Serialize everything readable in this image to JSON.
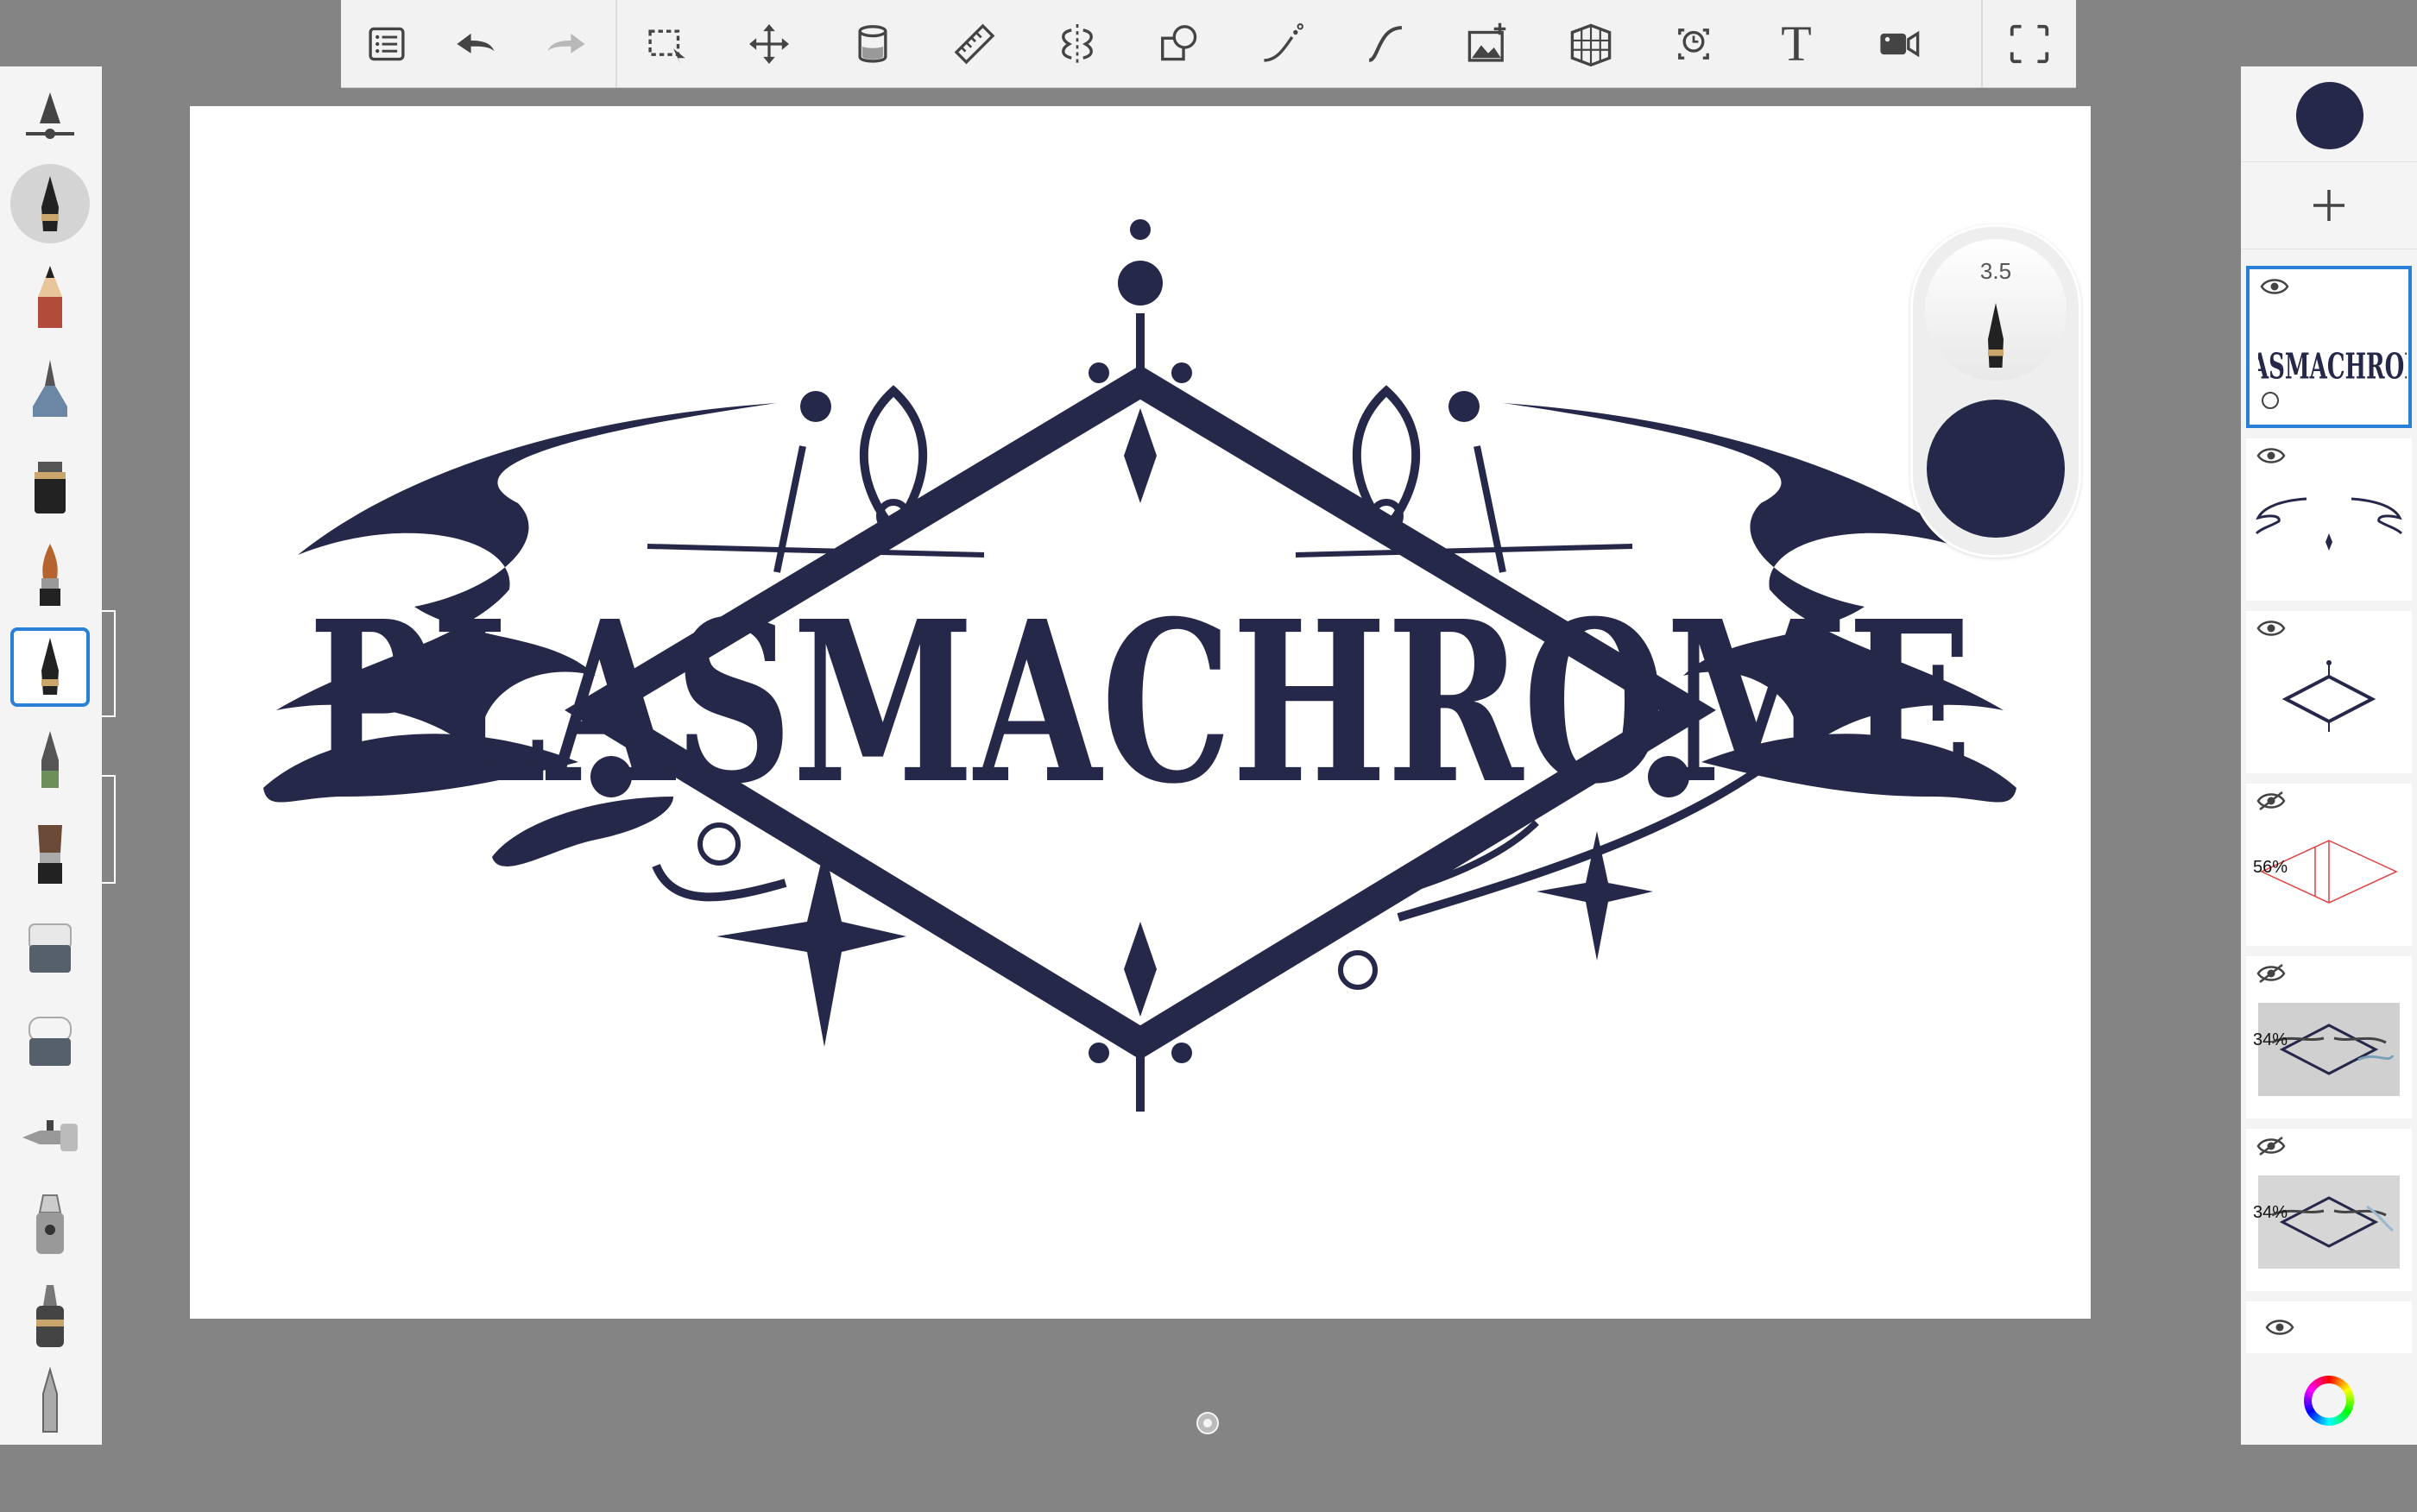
{
  "toolbar": {
    "icons": [
      "list-icon",
      "undo-icon",
      "redo-icon",
      "selection-icon",
      "transform-icon",
      "fill-icon",
      "ruler-icon",
      "symmetry-icon",
      "shape-icon",
      "stroke-icon",
      "curve-icon",
      "import-image-icon",
      "perspective-icon",
      "time-lapse-icon",
      "text-icon",
      "record-icon",
      "fullscreen-icon"
    ],
    "text_tool_label": "T"
  },
  "brush_palette": {
    "brushes": [
      "brush-size-slider",
      "ballpoint-pen",
      "pencil",
      "airbrush",
      "marker",
      "paint-brush",
      "ink-pen",
      "fine-pen",
      "flat-brush",
      "eraser-hard",
      "eraser-soft",
      "smudge",
      "chisel-marker",
      "fineliner",
      "stylus"
    ],
    "active_brush": "ink-pen"
  },
  "brush_puck": {
    "size_value": "3.5",
    "color": "#262849"
  },
  "layers_panel": {
    "current_color": "#262849",
    "layers": [
      {
        "name": "plasmachrome-lettering",
        "visible": true,
        "selected": true,
        "opacity_label": ""
      },
      {
        "name": "ornament-swirls",
        "visible": true,
        "selected": false,
        "opacity_label": ""
      },
      {
        "name": "diamond-frame",
        "visible": true,
        "selected": false,
        "opacity_label": ""
      },
      {
        "name": "red-guide",
        "visible": false,
        "selected": false,
        "opacity_label": "56%"
      },
      {
        "name": "sketch-reference-1",
        "visible": false,
        "selected": false,
        "opacity_label": "34%"
      },
      {
        "name": "sketch-reference-2",
        "visible": false,
        "selected": false,
        "opacity_label": "34%"
      },
      {
        "name": "background",
        "visible": true,
        "selected": false,
        "opacity_label": ""
      }
    ]
  },
  "canvas": {
    "artwork_text": "PLASMACHROME",
    "ink_color": "#262849",
    "background": "#ffffff"
  },
  "colors": {
    "accent": "#2a7fd6",
    "ink": "#262849",
    "workspace": "#848484"
  }
}
